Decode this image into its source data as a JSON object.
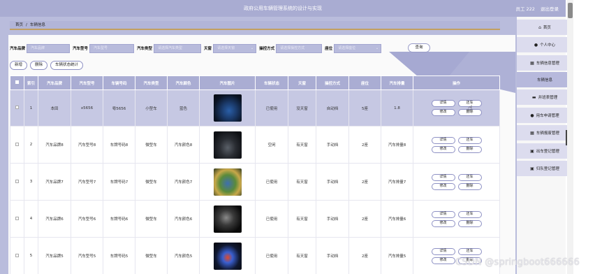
{
  "header": {
    "title": "政府公用车辆管理系统的设计与实现",
    "user": "员工 222",
    "logout": "退出登录"
  },
  "breadcrumb": {
    "home": "首页",
    "sep": "/",
    "current": "车辆信息"
  },
  "search": {
    "brand_label": "汽车品牌",
    "brand_placeholder": "汽车品牌",
    "model_label": "汽车型号",
    "model_placeholder": "汽车型号",
    "type_label": "汽车类型",
    "type_placeholder": "请选择汽车类型",
    "sunroof_label": "天窗",
    "sunroof_placeholder": "请选择天窗",
    "control_label": "操控方式",
    "control_placeholder": "请选择操控方式",
    "seats_label": "座位",
    "seats_placeholder": "请选择座位",
    "search_button": "查询"
  },
  "actions": {
    "add": "新增",
    "delete": "删除",
    "stats": "车辆状态统计"
  },
  "table": {
    "headers": [
      "索引",
      "汽车品牌",
      "汽车型号",
      "车辆号码",
      "汽车类型",
      "汽车颜色",
      "汽车图片",
      "车辆状态",
      "天窗",
      "操控方式",
      "座位",
      "汽车排量",
      "操作"
    ],
    "rows": [
      {
        "index": "1",
        "brand": "本田",
        "model": "x5656",
        "plate": "粤5656",
        "type": "小型车",
        "color": "蓝色",
        "status": "已使用",
        "sunroof": "没天窗",
        "control": "自动挡",
        "seats": "5座",
        "displacement": "1.8"
      },
      {
        "index": "2",
        "brand": "汽车品牌8",
        "model": "汽车型号8",
        "plate": "车牌号码8",
        "type": "微型车",
        "color": "汽车颜色8",
        "status": "空闲",
        "sunroof": "有天窗",
        "control": "手动挡",
        "seats": "2座",
        "displacement": "汽车排量8"
      },
      {
        "index": "3",
        "brand": "汽车品牌7",
        "model": "汽车型号7",
        "plate": "车牌号码7",
        "type": "微型车",
        "color": "汽车颜色7",
        "status": "已使用",
        "sunroof": "有天窗",
        "control": "手动挡",
        "seats": "2座",
        "displacement": "汽车排量7"
      },
      {
        "index": "4",
        "brand": "汽车品牌6",
        "model": "汽车型号6",
        "plate": "车牌号码6",
        "type": "微型车",
        "color": "汽车颜色6",
        "status": "已使用",
        "sunroof": "有天窗",
        "control": "手动挡",
        "seats": "2座",
        "displacement": "汽车排量6"
      },
      {
        "index": "5",
        "brand": "汽车品牌5",
        "model": "汽车型号5",
        "plate": "车牌号码5",
        "type": "微型车",
        "color": "汽车颜色5",
        "status": "已使用",
        "sunroof": "有天窗",
        "control": "手动挡",
        "seats": "2座",
        "displacement": "汽车排量5"
      }
    ],
    "op_labels": {
      "detail": "详情",
      "return": "还车",
      "edit": "修改",
      "delete": "删除"
    }
  },
  "sidebar": {
    "items": [
      {
        "label": "首页",
        "icon": "home-icon"
      },
      {
        "label": "个人中心",
        "icon": "user-icon"
      },
      {
        "label": "车辆信息管理",
        "icon": "grid-icon"
      },
      {
        "label": "车辆信息",
        "icon": ""
      },
      {
        "label": "井班表管理",
        "icon": "car-icon"
      },
      {
        "label": "用车申请管理",
        "icon": "user-icon"
      },
      {
        "label": "车辆报废管理",
        "icon": "grid-icon"
      },
      {
        "label": "出车登记管理",
        "icon": "doc-icon"
      },
      {
        "label": "归队登记管理",
        "icon": "doc-icon"
      }
    ]
  },
  "watermark": "CSDN @springboot666666",
  "colors": {
    "accent": "#a9acd2",
    "panel": "#b9bcdc",
    "header": "#aaadd3",
    "row_active": "#c6c8e3"
  }
}
